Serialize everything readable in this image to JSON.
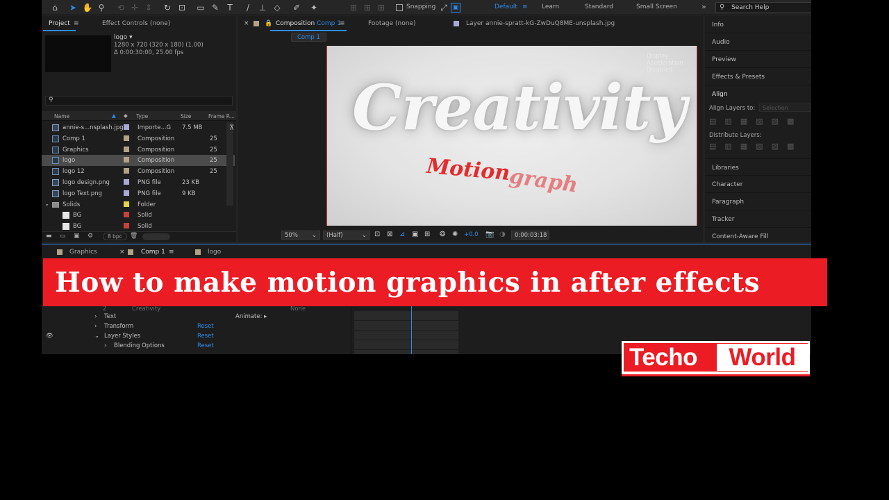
{
  "toolbar": {
    "snapping": "Snapping",
    "workspaces": [
      "Default",
      "Learn",
      "Standard",
      "Small Screen"
    ],
    "active_workspace": "Default",
    "search_placeholder": "Search Help"
  },
  "project_panel": {
    "tabs": [
      "Project",
      "Effect Controls (none)"
    ],
    "selected_name": "logo ▾",
    "selected_info1": "1280 x 720  (320 x 180) (1.00)",
    "selected_info2": "Δ 0:00:30:00, 25.00 fps",
    "columns": [
      "Name",
      "Type",
      "Size",
      "Frame R..."
    ],
    "items": [
      {
        "name": "annie-s...nsplash.jpg",
        "type": "Importe...G",
        "size": "7.5 MB",
        "fps": "",
        "label_color": "#a9a9d6",
        "kind": "file"
      },
      {
        "name": "Comp 1",
        "type": "Composition",
        "size": "",
        "fps": "25",
        "label_color": "#b3a386",
        "kind": "comp"
      },
      {
        "name": "Graphics",
        "type": "Composition",
        "size": "",
        "fps": "25",
        "label_color": "#b3a386",
        "kind": "comp"
      },
      {
        "name": "logo",
        "type": "Composition",
        "size": "",
        "fps": "25",
        "label_color": "#b3a386",
        "kind": "comp"
      },
      {
        "name": "logo 12",
        "type": "Composition",
        "size": "",
        "fps": "25",
        "label_color": "#b3a386",
        "kind": "comp"
      },
      {
        "name": "logo design.png",
        "type": "PNG file",
        "size": "23 KB",
        "fps": "",
        "label_color": "#a9a9d6",
        "kind": "file"
      },
      {
        "name": "logo Text.png",
        "type": "PNG file",
        "size": "9 KB",
        "fps": "",
        "label_color": "#a9a9d6",
        "kind": "file"
      },
      {
        "name": "Solids",
        "type": "Folder",
        "size": "",
        "fps": "",
        "label_color": "#e4d44a",
        "kind": "folder"
      },
      {
        "name": "BG",
        "type": "Solid",
        "size": "",
        "fps": "",
        "label_color": "#c8413b",
        "kind": "solid"
      },
      {
        "name": "BG",
        "type": "Solid",
        "size": "",
        "fps": "",
        "label_color": "#c8413b",
        "kind": "solid"
      }
    ],
    "bpc": "8 bpc"
  },
  "composition_panel": {
    "tab_composition": "Composition",
    "tab_comp_name": "Comp 1",
    "tab_footage": "Footage (none)",
    "tab_layer": "Layer  annie-spratt-kG-ZwDuQ8ME-unsplash.jpg",
    "breadcrumb": "Comp 1",
    "notice": "Display Acceleration Disabled",
    "canvas_title": "Creativity",
    "canvas_subtitle": "Motion",
    "canvas_subtitle2": "graph",
    "zoom": "50%",
    "resolution": "(Half)",
    "exposure": "+0.0",
    "timecode": "0:00:03:18"
  },
  "right_panel": {
    "items_top": [
      "Info",
      "Audio",
      "Preview",
      "Effects & Presets",
      "Align"
    ],
    "align_layers_to": "Align Layers to:",
    "align_target": "Selection",
    "distribute": "Distribute Layers:",
    "items_bottom": [
      "Libraries",
      "Character",
      "Paragraph",
      "Tracker",
      "Content-Aware Fill"
    ]
  },
  "timeline": {
    "tabs": [
      "Graphics",
      "Comp 1",
      "logo"
    ],
    "layer_name": "Creativity",
    "layer_index": "2",
    "parent": "None",
    "rows": [
      {
        "label": "Text",
        "value": ""
      },
      {
        "label": "Transform",
        "value": "Reset"
      },
      {
        "label": "Layer Styles",
        "value": "Reset"
      },
      {
        "label": "Blending Options",
        "value": "Reset"
      }
    ],
    "animate_label": "Animate:"
  },
  "overlay": {
    "banner": "How to make motion graphics in after effects",
    "brand_left": "Techo",
    "brand_right": "World"
  }
}
